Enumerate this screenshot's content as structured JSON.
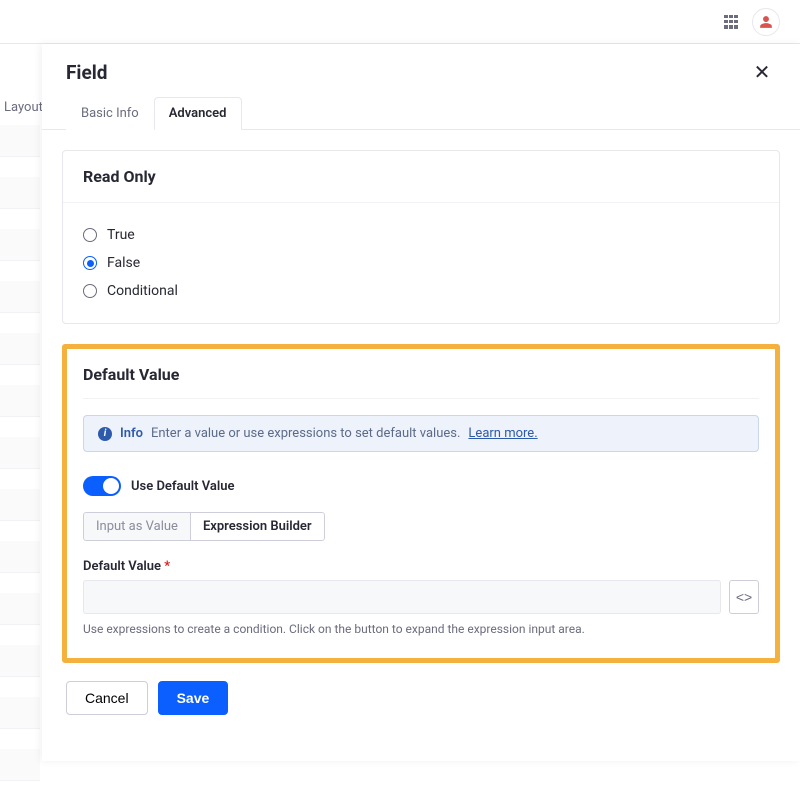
{
  "topbar": {
    "apps_icon": "apps",
    "user_icon": "user"
  },
  "background": {
    "layouts_label": "Layouts"
  },
  "panel": {
    "title": "Field",
    "tabs": [
      {
        "label": "Basic Info",
        "active": false
      },
      {
        "label": "Advanced",
        "active": true
      }
    ],
    "read_only": {
      "title": "Read Only",
      "options": [
        "True",
        "False",
        "Conditional"
      ],
      "selected": "False"
    },
    "default_value": {
      "title": "Default Value",
      "info_label": "Info",
      "info_text": "Enter a value or use expressions to set default values.",
      "learn_more": "Learn more.",
      "toggle_label": "Use Default Value",
      "toggle_on": true,
      "mode_options": [
        "Input as Value",
        "Expression Builder"
      ],
      "mode_selected": "Expression Builder",
      "field_label": "Default Value",
      "required": true,
      "field_value": "",
      "help_text": "Use expressions to create a condition. Click on the button to expand the expression input area."
    },
    "buttons": {
      "cancel": "Cancel",
      "save": "Save"
    }
  }
}
